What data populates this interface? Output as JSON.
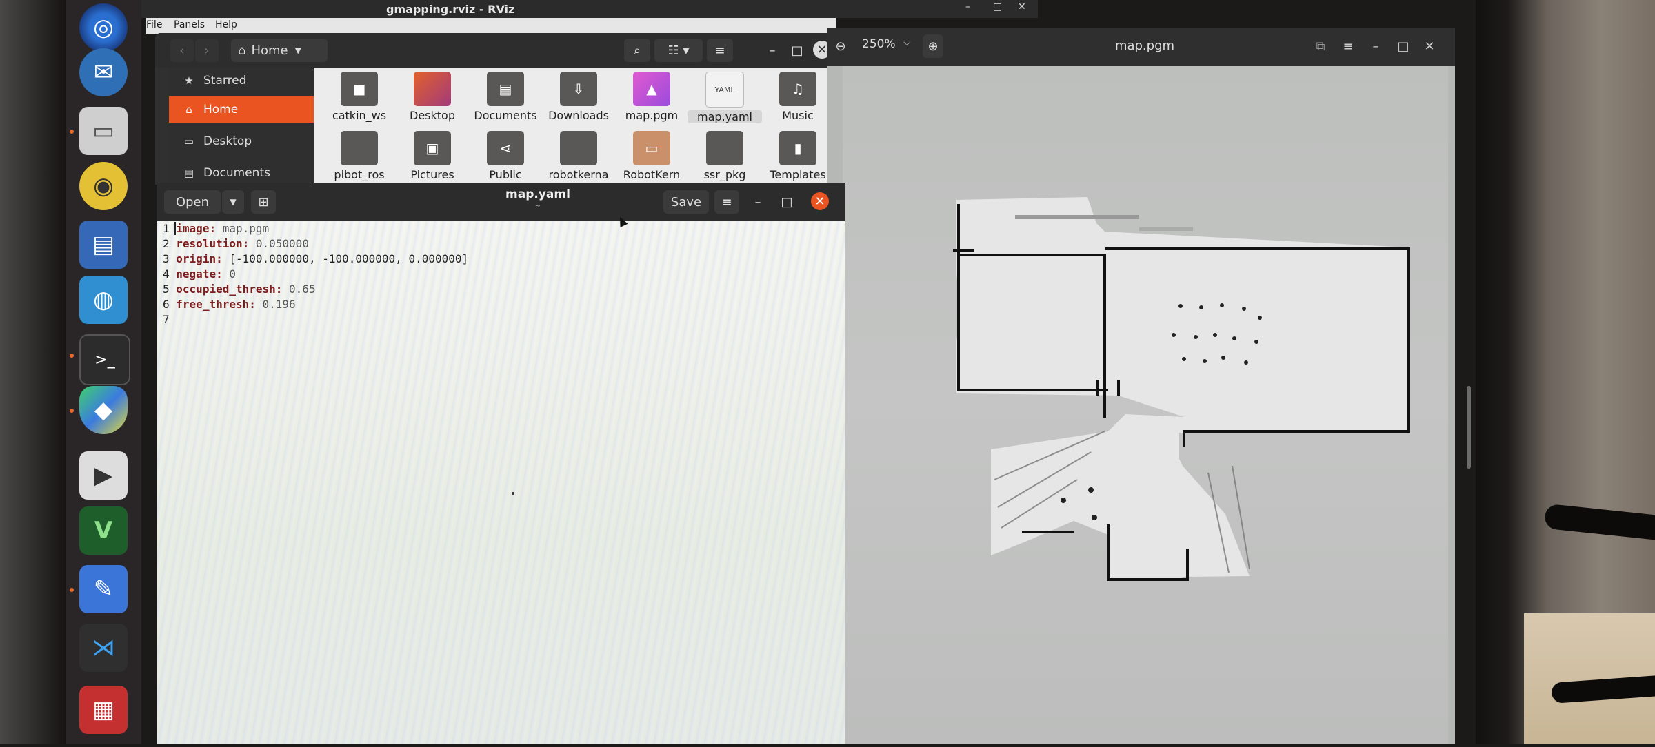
{
  "rviz": {
    "title": "gmapping.rviz - RViz",
    "menu": [
      "File",
      "Panels",
      "Help"
    ]
  },
  "nautilus": {
    "location": "Home",
    "sidebar": [
      "Starred",
      "Home",
      "Desktop",
      "Documents"
    ],
    "files": [
      {
        "name": "catkin_ws",
        "icon": "folder-icon"
      },
      {
        "name": "Desktop",
        "icon": "desktop-folder-icon"
      },
      {
        "name": "Documents",
        "icon": "documents-folder-icon"
      },
      {
        "name": "Downloads",
        "icon": "downloads-folder-icon"
      },
      {
        "name": "map.pgm",
        "icon": "image-file-icon"
      },
      {
        "name": "map.yaml",
        "icon": "yaml-file-icon"
      },
      {
        "name": "Music",
        "icon": "music-folder-icon"
      },
      {
        "name": "pibot_ros",
        "icon": "folder-icon"
      },
      {
        "name": "Pictures",
        "icon": "pictures-folder-icon"
      },
      {
        "name": "Public",
        "icon": "public-folder-icon"
      },
      {
        "name": "robotkerna",
        "icon": "folder-icon"
      },
      {
        "name": "RobotKern",
        "icon": "archive-file-icon"
      },
      {
        "name": "ssr_pkg",
        "icon": "folder-icon"
      },
      {
        "name": "Templates",
        "icon": "templates-folder-icon"
      }
    ]
  },
  "gedit": {
    "title": "map.yaml",
    "subtitle": "~",
    "open_label": "Open",
    "save_label": "Save",
    "lines": [
      {
        "n": "1",
        "key": "image:",
        "value": " map.pgm"
      },
      {
        "n": "2",
        "key": "resolution:",
        "value": " 0.050000"
      },
      {
        "n": "3",
        "key": "origin:",
        "value": " [-100.000000, -100.000000, 0.000000]"
      },
      {
        "n": "4",
        "key": "negate:",
        "value": " 0"
      },
      {
        "n": "5",
        "key": "occupied_thresh:",
        "value": " 0.65"
      },
      {
        "n": "6",
        "key": "free_thresh:",
        "value": " 0.196"
      },
      {
        "n": "7",
        "key": "",
        "value": ""
      }
    ]
  },
  "viewer": {
    "title": "map.pgm",
    "zoom": "250%"
  },
  "colors": {
    "accent": "#e95420",
    "close": "#e95420"
  }
}
